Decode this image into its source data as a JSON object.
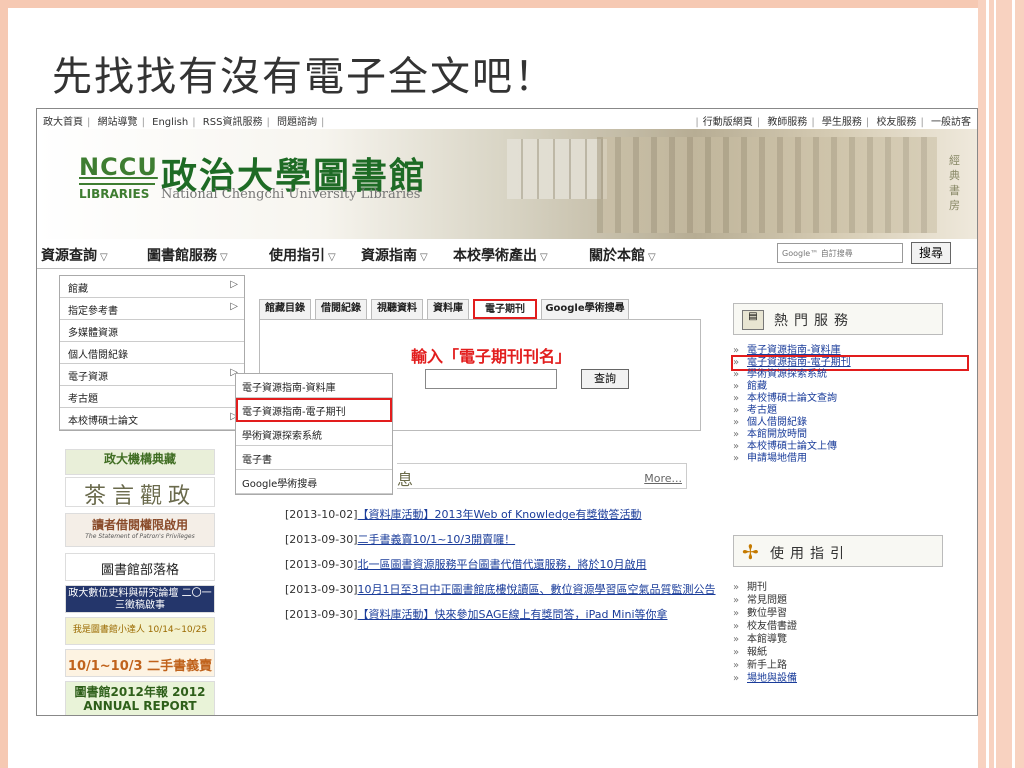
{
  "slide": {
    "title": "先找找有沒有電子全文吧！"
  },
  "toplinks": {
    "left": [
      "政大首頁",
      "網站導覽",
      "English",
      "RSS資訊服務",
      "問題諮詢"
    ],
    "right": [
      "行動版網頁",
      "教師服務",
      "學生服務",
      "校友服務",
      "一般訪客"
    ]
  },
  "banner": {
    "nccu": "NCCU",
    "libraries": "LIBRARIES",
    "name_cn": "政治大學圖書館",
    "name_en": "National Chengchi University Libraries",
    "side_text": "經典書房"
  },
  "nav": {
    "items": [
      "資源查詢",
      "圖書館服務",
      "使用指引",
      "資源指南",
      "本校學術產出",
      "關於本館"
    ],
    "search_placeholder": "Google™ 自訂搜尋",
    "search_button": "搜尋"
  },
  "menu": {
    "items": [
      {
        "label": "館藏",
        "arrow": "▷"
      },
      {
        "label": "指定參考書",
        "arrow": "▷"
      },
      {
        "label": "多媒體資源",
        "arrow": ""
      },
      {
        "label": "個人借閱紀錄",
        "arrow": ""
      },
      {
        "label": "電子資源",
        "arrow": "▷"
      },
      {
        "label": "考古題",
        "arrow": ""
      },
      {
        "label": "本校博碩士論文",
        "arrow": "▷"
      }
    ],
    "submenu": [
      "電子資源指南-資料庫",
      "電子資源指南-電子期刊",
      "學術資源探索系統",
      "電子書",
      "Google學術搜尋"
    ]
  },
  "leftlogos": {
    "l1": "政大機構典藏",
    "l2": "茶言觀政",
    "l3": "讀者借閱權限啟用",
    "l3_sub": "The Statement of Patron's Privileges",
    "l4": "圖書館部落格",
    "l5": "政大數位史料與研究論壇 二〇一三徵稿啟事",
    "l6": "我是圖書館小達人 10/14~10/25",
    "l7": "10/1~10/3 二手書義賣",
    "l8": "圖書館2012年報 2012 ANNUAL REPORT"
  },
  "tabs": {
    "items": [
      "館藏目錄",
      "借閱紀錄",
      "視聽資料",
      "資料庫",
      "電子期刊",
      "Google學術搜尋"
    ],
    "active": "電子期刊"
  },
  "search_panel": {
    "callout": "輸入「電子期刊刊名」",
    "label_tail": "名",
    "button": "查詢"
  },
  "news": {
    "heading": "息",
    "more": "More...",
    "items": [
      {
        "date": "[2013-10-02]",
        "text": "【資料庫活動】2013年Web of Knowledge有獎徵答活動"
      },
      {
        "date": "[2013-09-30]",
        "text": "二手書義賣10/1~10/3開賣囉！"
      },
      {
        "date": "[2013-09-30]",
        "text": "北一區圖書資源服務平台圖書代借代還服務，將於10月啟用"
      },
      {
        "date": "[2013-09-30]",
        "text": "10月1日至3日中正圖書館底樓悅讀區、數位資源學習區空氣品質監測公告"
      },
      {
        "date": "[2013-09-30]",
        "text": "【資料庫活動】快來參加SAGE線上有獎問答，iPad Mini等你拿"
      }
    ]
  },
  "hot": {
    "heading": "熱門服務",
    "items": [
      "電子資源指南-資料庫",
      "電子資源指南-電子期刊",
      "學術資源探索系統",
      "館藏",
      "本校博碩士論文查詢",
      "考古題",
      "個人借閱紀錄",
      "本館開放時間",
      "本校博碩士論文上傳",
      "申請場地借用"
    ]
  },
  "guide": {
    "heading": "使用指引",
    "items": [
      "期刊",
      "常見問題",
      "數位學習",
      "校友借書證",
      "本館導覽",
      "報紙",
      "新手上路",
      "場地與設備"
    ]
  },
  "colors": {
    "highlight": "#e21d1d",
    "brand_green": "#1e6b25",
    "link_blue": "#1a3c9a",
    "slide_accent": "#f6c9b3"
  }
}
